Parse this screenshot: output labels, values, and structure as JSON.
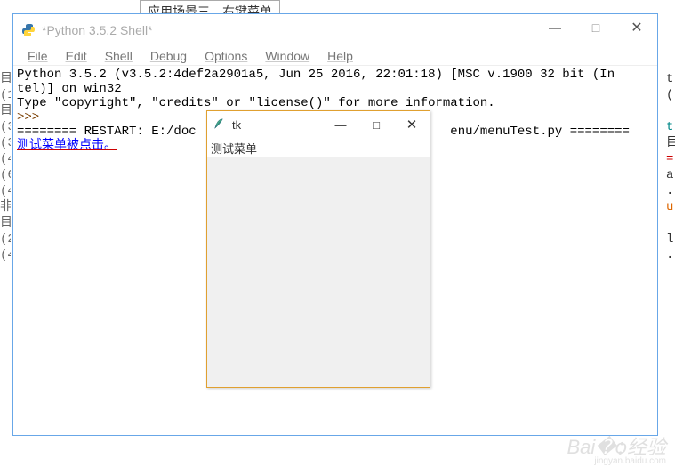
{
  "background": {
    "top_text": "应用场景三、右键菜单",
    "left_chars": "目\n(1\n目\n(3\n(3\n(4\n(6\n(4\n非\n目\n(2\n(4",
    "right_fragments": [
      "t",
      "(",
      "t",
      "目",
      "=",
      "a",
      ".",
      "u",
      "l",
      "."
    ]
  },
  "idle": {
    "title": "*Python 3.5.2 Shell*",
    "menus": [
      "File",
      "Edit",
      "Shell",
      "Debug",
      "Options",
      "Window",
      "Help"
    ],
    "line1": "Python 3.5.2 (v3.5.2:4def2a2901a5, Jun 25 2016, 22:01:18) [MSC v.1900 32 bit (In",
    "line2": "tel)] on win32",
    "line3": "Type \"copyright\", \"credits\" or \"license()\" for more information.",
    "prompt": ">>> ",
    "restart_left": "======== RESTART: E:/doc",
    "restart_right": "enu/menuTest.py ========",
    "output": "测试菜单被点击。"
  },
  "tk": {
    "title": "tk",
    "menu_label": "测试菜单"
  },
  "window_controls": {
    "minimize": "—",
    "maximize": "□",
    "close": "✕"
  },
  "watermark": {
    "main": "Bai�ѻ经验",
    "sub": "jingyan.baidu.com"
  }
}
